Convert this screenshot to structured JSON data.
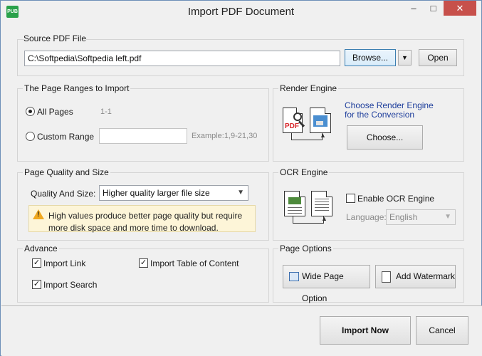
{
  "window": {
    "title": "Import PDF Document",
    "icon_label": "PUB",
    "minimize": "–",
    "maximize": "□",
    "close": "✕"
  },
  "source": {
    "title": "Source PDF File",
    "path": "C:\\Softpedia\\Softpedia left.pdf",
    "browse_label": "Browse...",
    "dropdown_glyph": "▼",
    "open_label": "Open"
  },
  "page_ranges": {
    "title": "The Page Ranges to Import",
    "all_pages_label": "All Pages",
    "all_pages_range": "1-1",
    "custom_label": "Custom Range",
    "custom_value": "",
    "example_text": "Example:1,9-21,30",
    "selected": "all"
  },
  "render_engine": {
    "title": "Render Engine",
    "description_line1": "Choose Render Engine",
    "description_line2": "for the Conversion",
    "choose_label": "Choose..."
  },
  "quality": {
    "title": "Page Quality and Size",
    "label": "Quality And Size:",
    "selected_option": "Higher quality larger file size",
    "warning_text": "High values produce better page quality but require more disk space and more time to download."
  },
  "ocr": {
    "title": "OCR Engine",
    "enable_label": "Enable OCR Engine",
    "enabled": false,
    "language_label": "Language:",
    "language_value": "English"
  },
  "advance": {
    "title": "Advance",
    "import_link_label": "Import Link",
    "import_link_checked": true,
    "import_toc_label": "Import Table of Content",
    "import_toc_checked": true,
    "import_search_label": "Import Search",
    "import_search_checked": true
  },
  "page_options": {
    "title": "Page Options",
    "wide_page_label": "Wide Page Option",
    "watermark_label": "Add Watermark"
  },
  "footer": {
    "import_label": "Import Now",
    "cancel_label": "Cancel"
  },
  "colors": {
    "close_button": "#c7504b",
    "link_text": "#1f3f9c",
    "warning_bg": "#fdf5d8",
    "warning_icon": "#f0a81e",
    "pdf_red": "#d8262a"
  },
  "icons": {
    "warning": "warning-icon",
    "pdf_document": "pdf-document-icon",
    "image_document": "image-document-icon",
    "ocr_documents": "ocr-documents-icon",
    "wide_page": "wide-page-icon",
    "watermark": "watermark-icon",
    "magnifier": "magnifier-icon"
  }
}
